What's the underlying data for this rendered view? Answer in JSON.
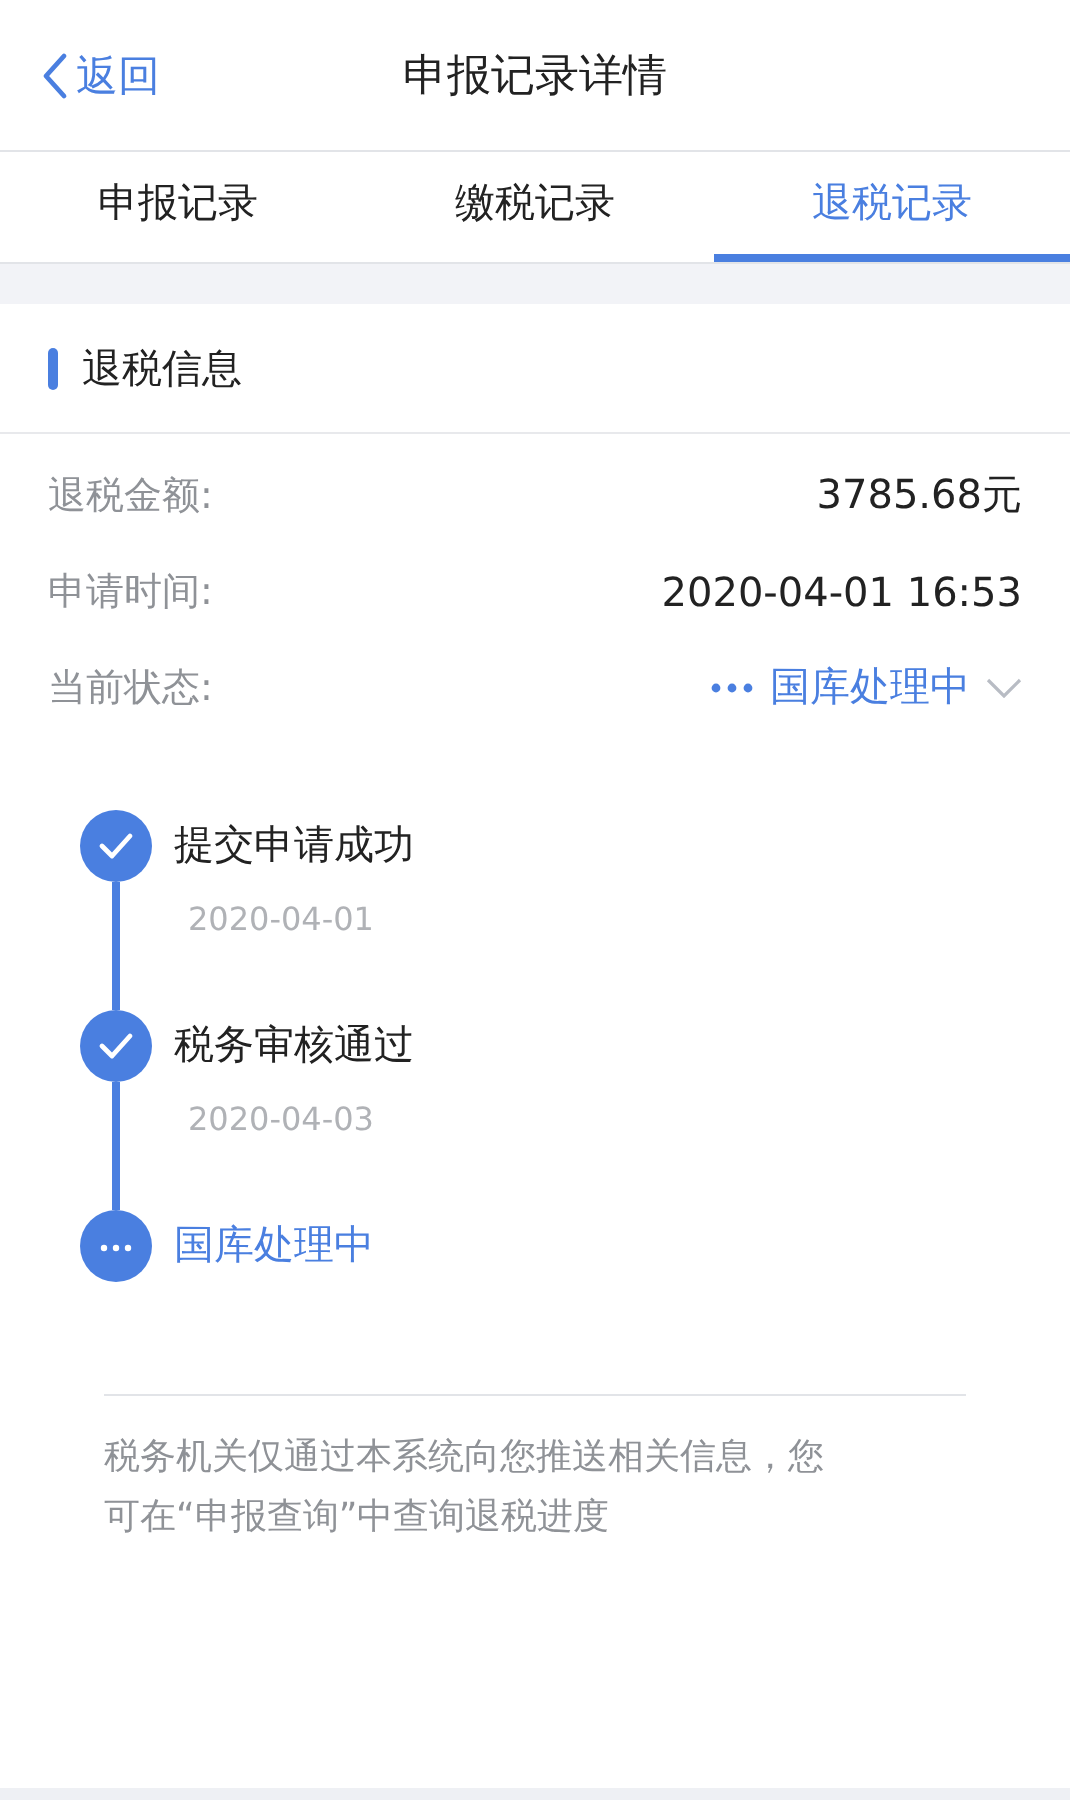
{
  "nav": {
    "back": "返回",
    "title": "申报记录详情"
  },
  "tabs": [
    {
      "label": "申报记录",
      "selected": false
    },
    {
      "label": "缴税记录",
      "selected": false
    },
    {
      "label": "退税记录",
      "selected": true
    }
  ],
  "section_title": "退税信息",
  "fields": [
    {
      "label": "退税金额:",
      "value": "3785.68元",
      "kind": "plain"
    },
    {
      "label": "申请时间:",
      "value": "2020-04-01 16:53",
      "kind": "plain"
    },
    {
      "label": "当前状态:",
      "value": "国库处理中",
      "kind": "status"
    }
  ],
  "timeline": [
    {
      "title": "提交申请成功",
      "date": "2020-04-01",
      "kind": "done"
    },
    {
      "title": "税务审核通过",
      "date": "2020-04-03",
      "kind": "done"
    },
    {
      "title": "国库处理中",
      "kind": "pending"
    }
  ],
  "note": "税务机关仅通过本系统向您推送相关信息，您可在“申报查询”中查询退税进度"
}
